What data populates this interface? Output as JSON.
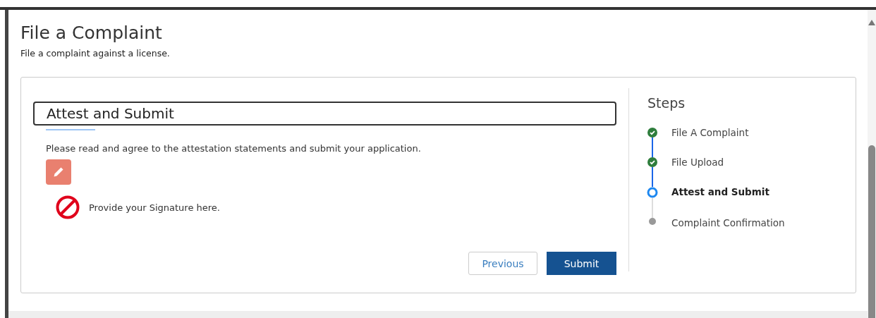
{
  "page": {
    "title": "File a Complaint",
    "subtitle": "File a complaint against a license."
  },
  "form": {
    "heading": "Attest and Submit",
    "instructions": "Please read and agree to the attestation statements and submit your application.",
    "signature_message": "Provide your Signature here."
  },
  "buttons": [
    {
      "label": "Previous",
      "kind": "secondary"
    },
    {
      "label": "Submit",
      "kind": "primary"
    }
  ],
  "steps": {
    "title": "Steps",
    "items": [
      {
        "label": "File A Complaint",
        "kind": "done",
        "selected": false
      },
      {
        "label": "File Upload",
        "kind": "done",
        "selected": false
      },
      {
        "label": "Attest and Submit",
        "kind": "current",
        "selected": true
      },
      {
        "label": "Complaint Confirmation",
        "kind": "pending",
        "selected": false
      }
    ]
  }
}
